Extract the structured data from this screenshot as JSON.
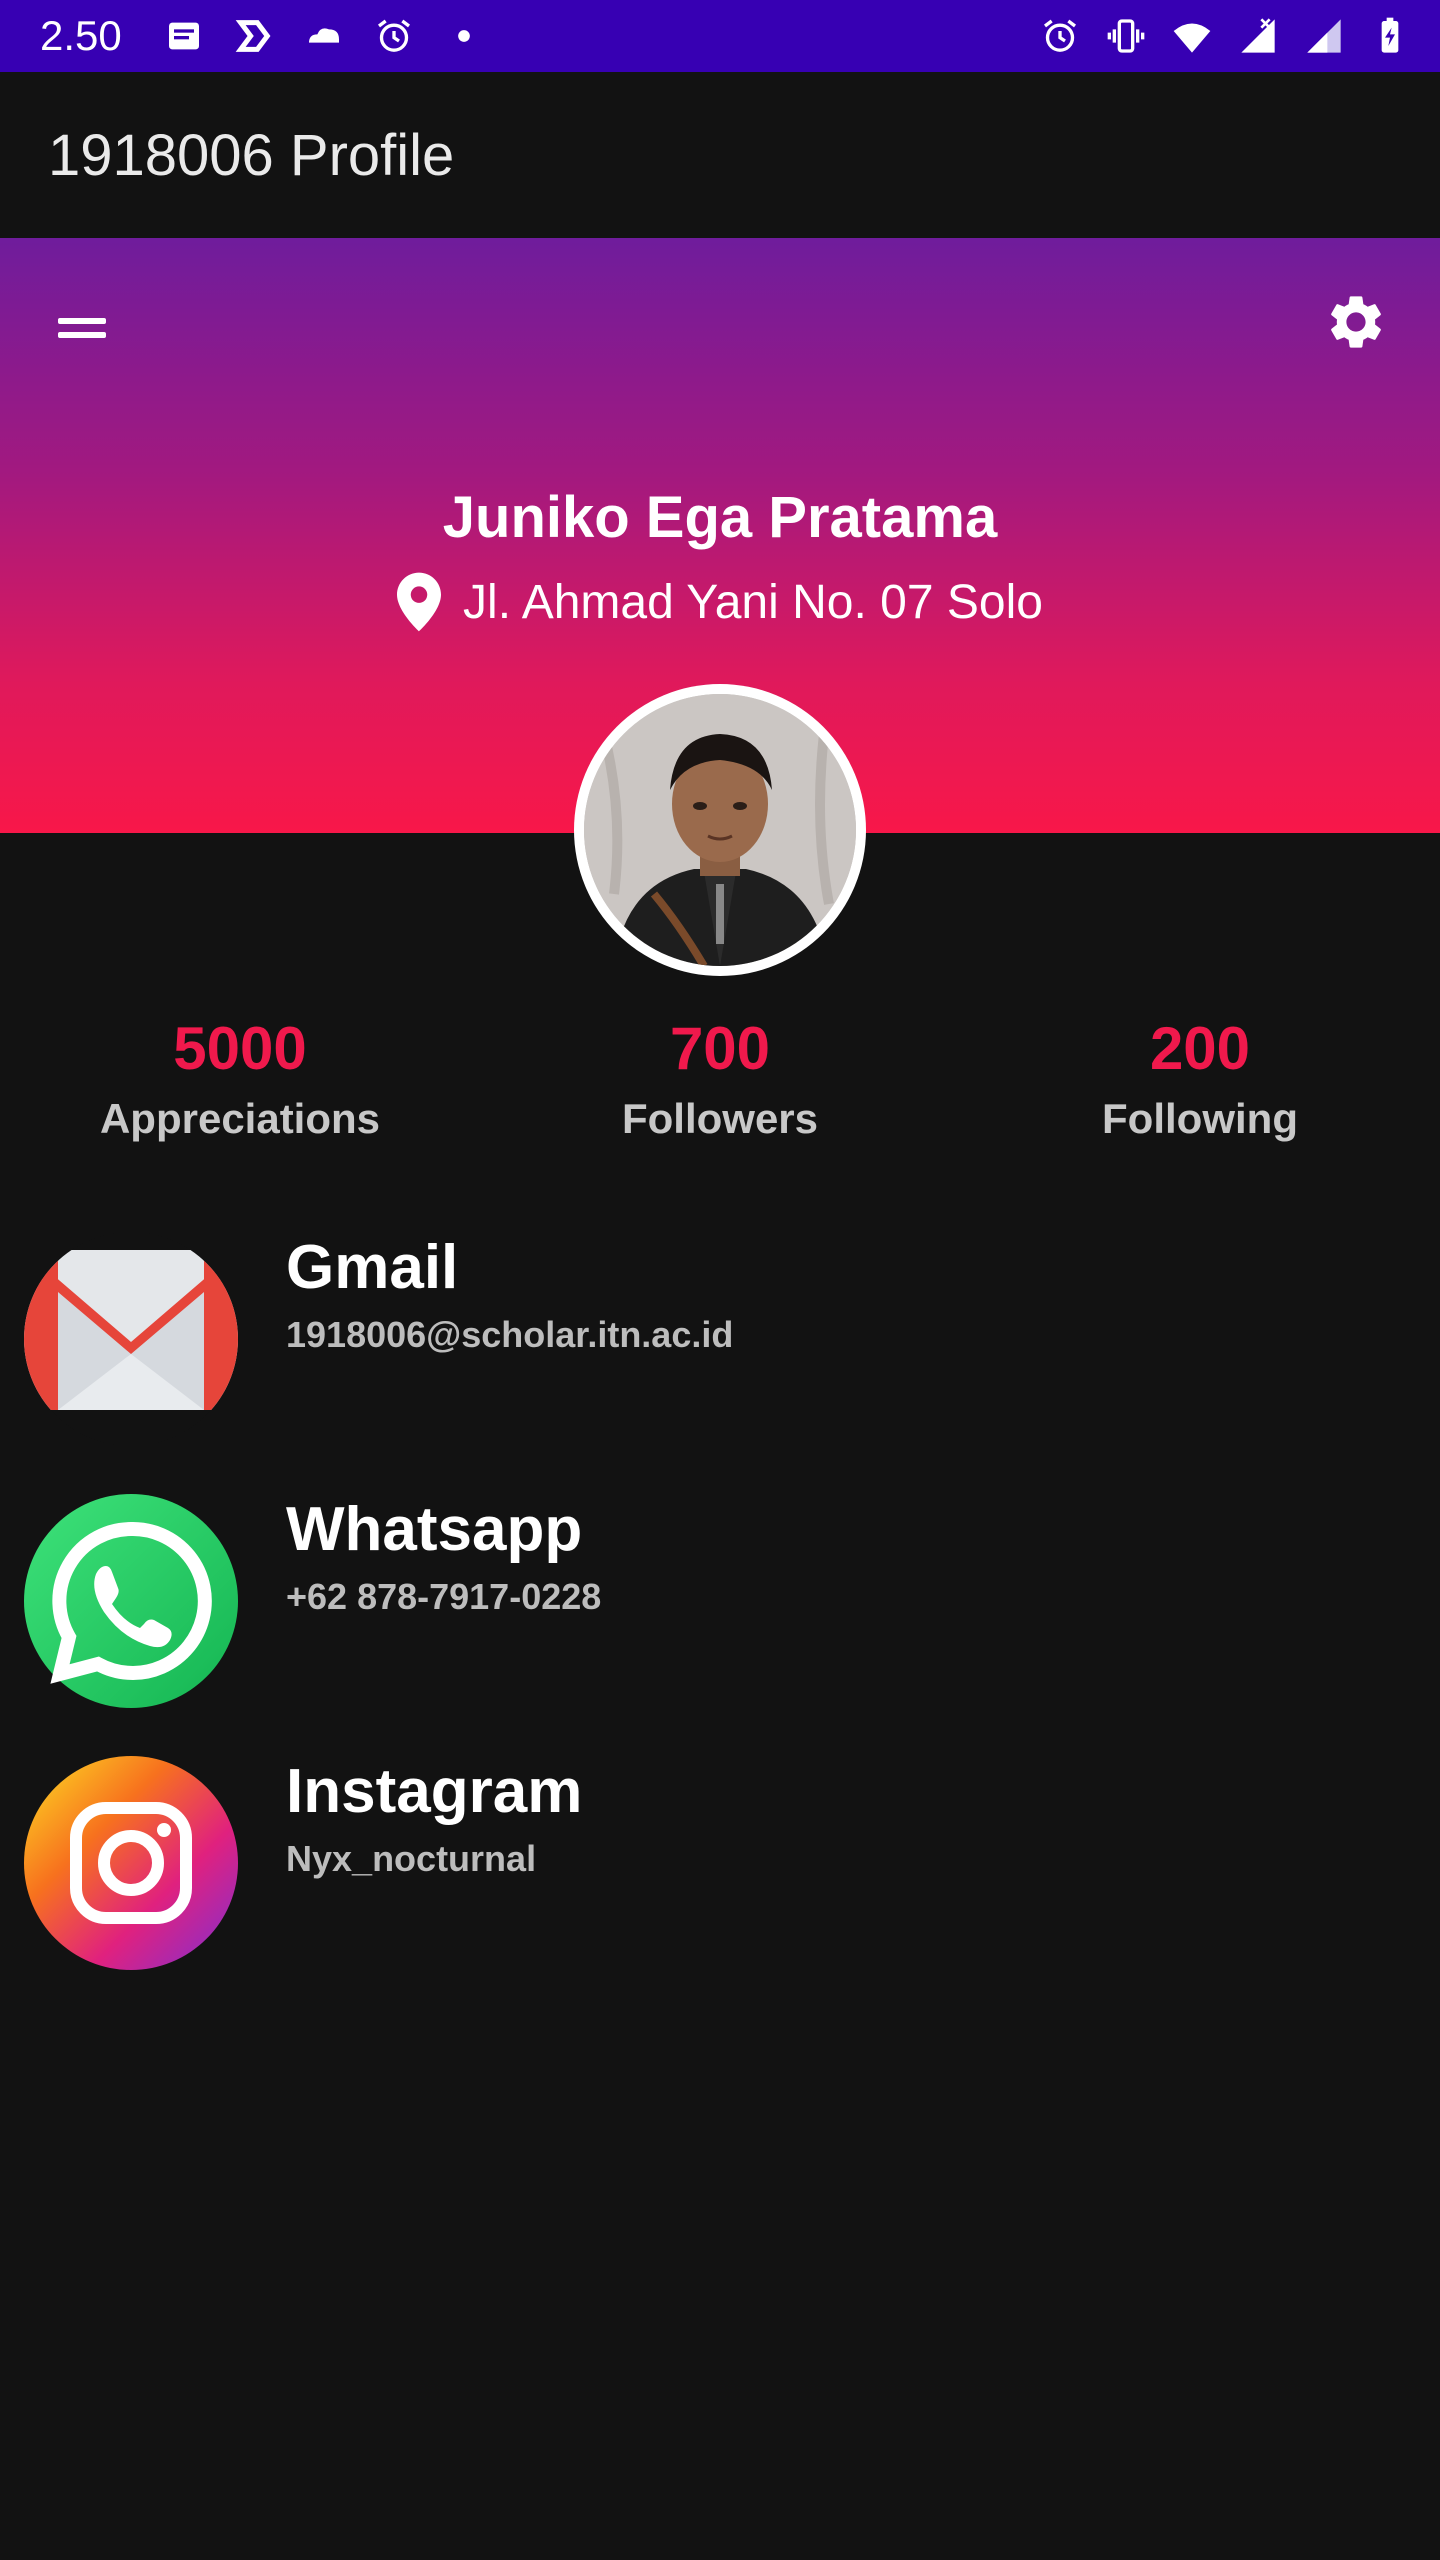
{
  "status_bar": {
    "time": "2.50",
    "left_icons": [
      "message-icon",
      "app-icon",
      "cloud-icon",
      "alarm-icon",
      "dot-icon"
    ],
    "right_icons": [
      "alarm-icon",
      "vibrate-icon",
      "wifi-icon",
      "signal-icon",
      "signal-icon",
      "battery-icon"
    ]
  },
  "app_bar": {
    "title": "1918006 Profile"
  },
  "header": {
    "menu_icon": "menu-icon",
    "settings_icon": "gear-icon",
    "name": "Juniko Ega Pratama",
    "address": "Jl. Ahmad Yani No. 07 Solo",
    "address_icon": "location-pin-icon"
  },
  "stats": [
    {
      "value": "5000",
      "label": "Appreciations"
    },
    {
      "value": "700",
      "label": "Followers"
    },
    {
      "value": "200",
      "label": "Following"
    }
  ],
  "contacts": [
    {
      "title": "Gmail",
      "subtitle": "1918006@scholar.itn.ac.id",
      "icon": "gmail-icon"
    },
    {
      "title": "Whatsapp",
      "subtitle": "+62 878-7917-0228",
      "icon": "whatsapp-icon"
    },
    {
      "title": "Instagram",
      "subtitle": "Nyx_nocturnal",
      "icon": "instagram-icon"
    }
  ],
  "colors": {
    "status_bar": "#3700b3",
    "accent": "#f0194c",
    "background": "#121212"
  }
}
